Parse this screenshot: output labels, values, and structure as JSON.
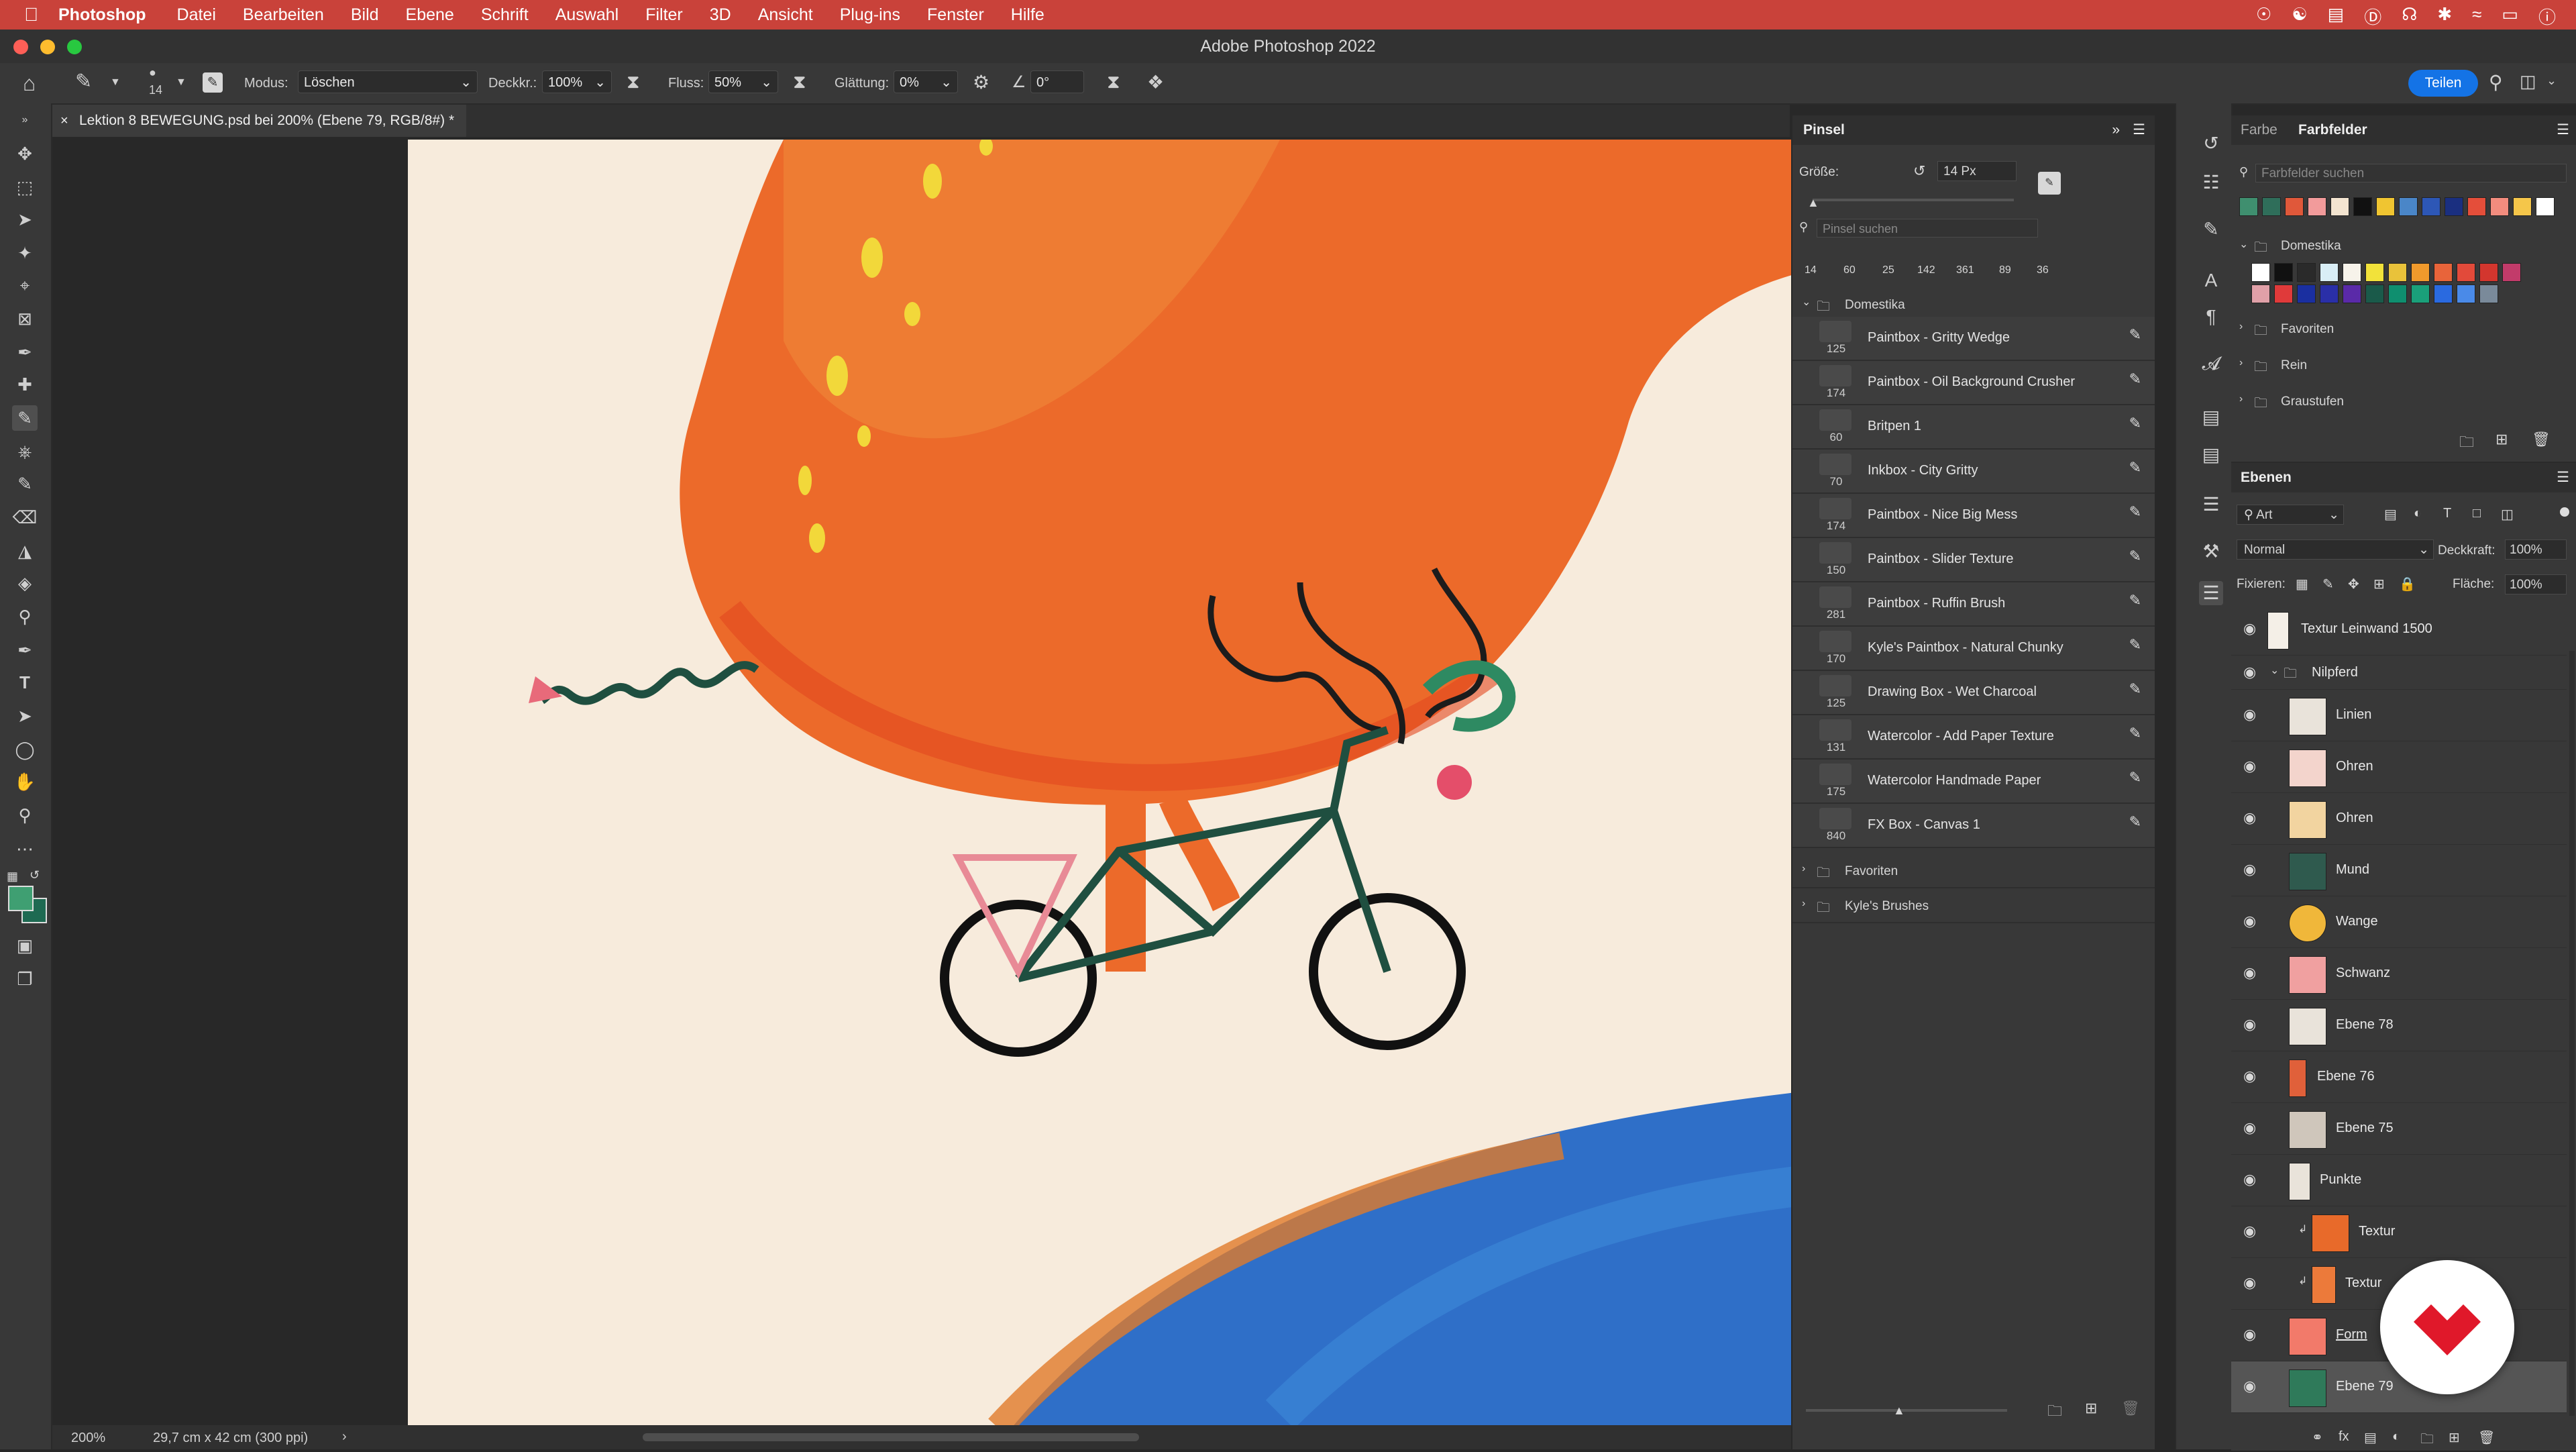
{
  "menubar": {
    "apple": "",
    "app": "Photoshop",
    "items": [
      "Datei",
      "Bearbeiten",
      "Bild",
      "Ebene",
      "Schrift",
      "Auswahl",
      "Filter",
      "3D",
      "Ansicht",
      "Plug-ins",
      "Fenster",
      "Hilfe"
    ]
  },
  "window": {
    "title": "Adobe Photoshop 2022"
  },
  "options": {
    "brush_size": "14",
    "modus_label": "Modus:",
    "modus_value": "Löschen",
    "deckkr_label": "Deckkr.:",
    "deckkr_value": "100%",
    "fluss_label": "Fluss:",
    "fluss_value": "50%",
    "glaettung_label": "Glättung:",
    "glaettung_value": "0%",
    "angle_value": "0°",
    "share_label": "Teilen"
  },
  "document": {
    "tab_title": "Lektion 8 BEWEGUNG.psd bei 200% (Ebene 79, RGB/8#) *",
    "zoom": "200%",
    "doc_size": "29,7 cm x 42 cm (300 ppi)"
  },
  "brush_panel": {
    "title": "Pinsel",
    "size_label": "Größe:",
    "size_value": "14 Px",
    "search_placeholder": "Pinsel suchen",
    "recent": [
      "14",
      "60",
      "25",
      "142",
      "361",
      "89",
      "36"
    ],
    "group": "Domestika",
    "brushes": [
      {
        "num": "125",
        "name": "Paintbox - Gritty Wedge"
      },
      {
        "num": "174",
        "name": "Paintbox - Oil Background Crusher"
      },
      {
        "num": "60",
        "name": "Britpen 1"
      },
      {
        "num": "70",
        "name": "Inkbox - City Gritty"
      },
      {
        "num": "174",
        "name": "Paintbox - Nice Big Mess"
      },
      {
        "num": "150",
        "name": "Paintbox - Slider Texture"
      },
      {
        "num": "281",
        "name": "Paintbox - Ruffin Brush"
      },
      {
        "num": "170",
        "name": "Kyle's Paintbox - Natural Chunky"
      },
      {
        "num": "125",
        "name": "Drawing Box - Wet Charcoal"
      },
      {
        "num": "131",
        "name": "Watercolor - Add Paper Texture"
      },
      {
        "num": "175",
        "name": "Watercolor Handmade Paper"
      },
      {
        "num": "840",
        "name": "FX Box - Canvas 1"
      }
    ],
    "folders": [
      "Favoriten",
      "Kyle's Brushes"
    ]
  },
  "swatch_panel": {
    "tab_farbe": "Farbe",
    "tab_farbfelder": "Farbfelder",
    "search_placeholder": "Farbfelder suchen",
    "recent_colors": [
      "#3f8f6f",
      "#2f6e5a",
      "#e0583a",
      "#f29b9b",
      "#f3e4d0",
      "#111111",
      "#f0c531",
      "#4a86c8",
      "#2d57b6",
      "#1a2f80",
      "#e44e3a",
      "#f28c7e",
      "#f5c64a",
      "#ffffff"
    ],
    "groups": [
      "Domestika",
      "Favoriten",
      "Rein",
      "Graustufen"
    ],
    "domestika_colors": [
      "#ffffff",
      "#111111",
      "#2a2a2a",
      "#d9eef6",
      "#f7f3ea",
      "#f2e23a",
      "#e9c23a",
      "#f09a2c",
      "#e8643a",
      "#e24a3a",
      "#d3362e",
      "#c23b6a",
      "#e0a0a8",
      "#e03a3a",
      "#1a2fa0",
      "#2a2fa8",
      "#5a2aa8",
      "#1a5a4a",
      "#0f8f6f",
      "#1aa07a",
      "#2a6ae0",
      "#4a8ae8",
      "#7a8a9a"
    ]
  },
  "layers_panel": {
    "title": "Ebenen",
    "filter": "Art",
    "blend_mode": "Normal",
    "opacity_label": "Deckkraft:",
    "opacity_value": "100%",
    "lock_label": "Fixieren:",
    "fill_label": "Fläche:",
    "fill_value": "100%",
    "layers": [
      {
        "name": "Textur Leinwand 1500",
        "indent": 0
      },
      {
        "name": "Nilpferd",
        "indent": 0,
        "group": true
      },
      {
        "name": "Linien",
        "indent": 1
      },
      {
        "name": "Ohren",
        "indent": 1
      },
      {
        "name": "Ohren",
        "indent": 1
      },
      {
        "name": "Mund",
        "indent": 1
      },
      {
        "name": "Wange",
        "indent": 1
      },
      {
        "name": "Schwanz",
        "indent": 1
      },
      {
        "name": "Ebene 78",
        "indent": 1
      },
      {
        "name": "Ebene 76",
        "indent": 1
      },
      {
        "name": "Ebene 75",
        "indent": 1
      },
      {
        "name": "Punkte",
        "indent": 1
      },
      {
        "name": "Textur",
        "indent": 2
      },
      {
        "name": "Textur",
        "indent": 2
      },
      {
        "name": "Form",
        "indent": 1
      },
      {
        "name": "Ebene 79",
        "indent": 1,
        "selected": true
      }
    ]
  },
  "colors": {
    "menubar": "#c9423a",
    "share_button": "#1473e6",
    "hippo_orange": "#ec6a2a",
    "canvas_bg": "#f7ebdc",
    "globe_blue": "#2f6fc8"
  }
}
